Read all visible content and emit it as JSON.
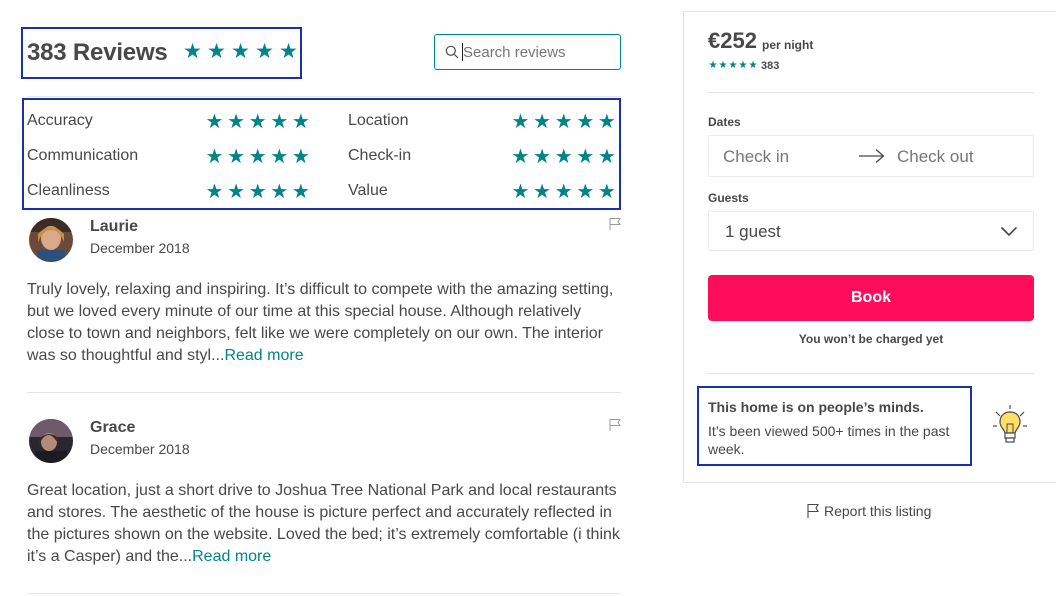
{
  "reviews": {
    "title": "383 Reviews",
    "overall_rating": 5,
    "search": {
      "placeholder": "Search reviews"
    },
    "categories": [
      {
        "label": "Accuracy",
        "rating": 5
      },
      {
        "label": "Location",
        "rating": 5
      },
      {
        "label": "Communication",
        "rating": 5
      },
      {
        "label": "Check-in",
        "rating": 5
      },
      {
        "label": "Cleanliness",
        "rating": 5
      },
      {
        "label": "Value",
        "rating": 5
      }
    ],
    "items": [
      {
        "name": "Laurie",
        "date": "December 2018",
        "text": "Truly lovely, relaxing and inspiring. It’s difficult to compete with the amazing setting, but we loved every minute of our time at this special house. Although relatively close to town and neighbors, felt like we were completely on our own. The interior was so thoughtful and styl...",
        "read_more": "Read more"
      },
      {
        "name": "Grace",
        "date": "December 2018",
        "text": "Great location, just a short drive to Joshua Tree National Park and local restaurants and stores. The aesthetic of the house is picture perfect and accurately reflected in the pictures shown on the website. Loved the bed; it’s extremely comfortable (i think it’s a Casper) and the...",
        "read_more": "Read more"
      }
    ]
  },
  "booking": {
    "price": "€252",
    "per_night": "per night",
    "rating": 5,
    "review_count": "383",
    "dates_label": "Dates",
    "check_in_placeholder": "Check in",
    "check_out_placeholder": "Check out",
    "guests_label": "Guests",
    "guests_value": "1 guest",
    "book_label": "Book",
    "charged_note": "You won’t be charged yet",
    "notice_title": "This home is on people’s minds.",
    "notice_body": "It’s been viewed 500+ times in the past week.",
    "report_label": "Report this listing"
  },
  "colors": {
    "accent": "#008489",
    "book_button": "#ff0c5c",
    "highlight_border": "#1a2fb0",
    "text": "#484848"
  },
  "icons": [
    "star-icon",
    "search-icon",
    "flag-icon",
    "arrow-right-icon",
    "chevron-down-icon",
    "lightbulb-icon"
  ]
}
